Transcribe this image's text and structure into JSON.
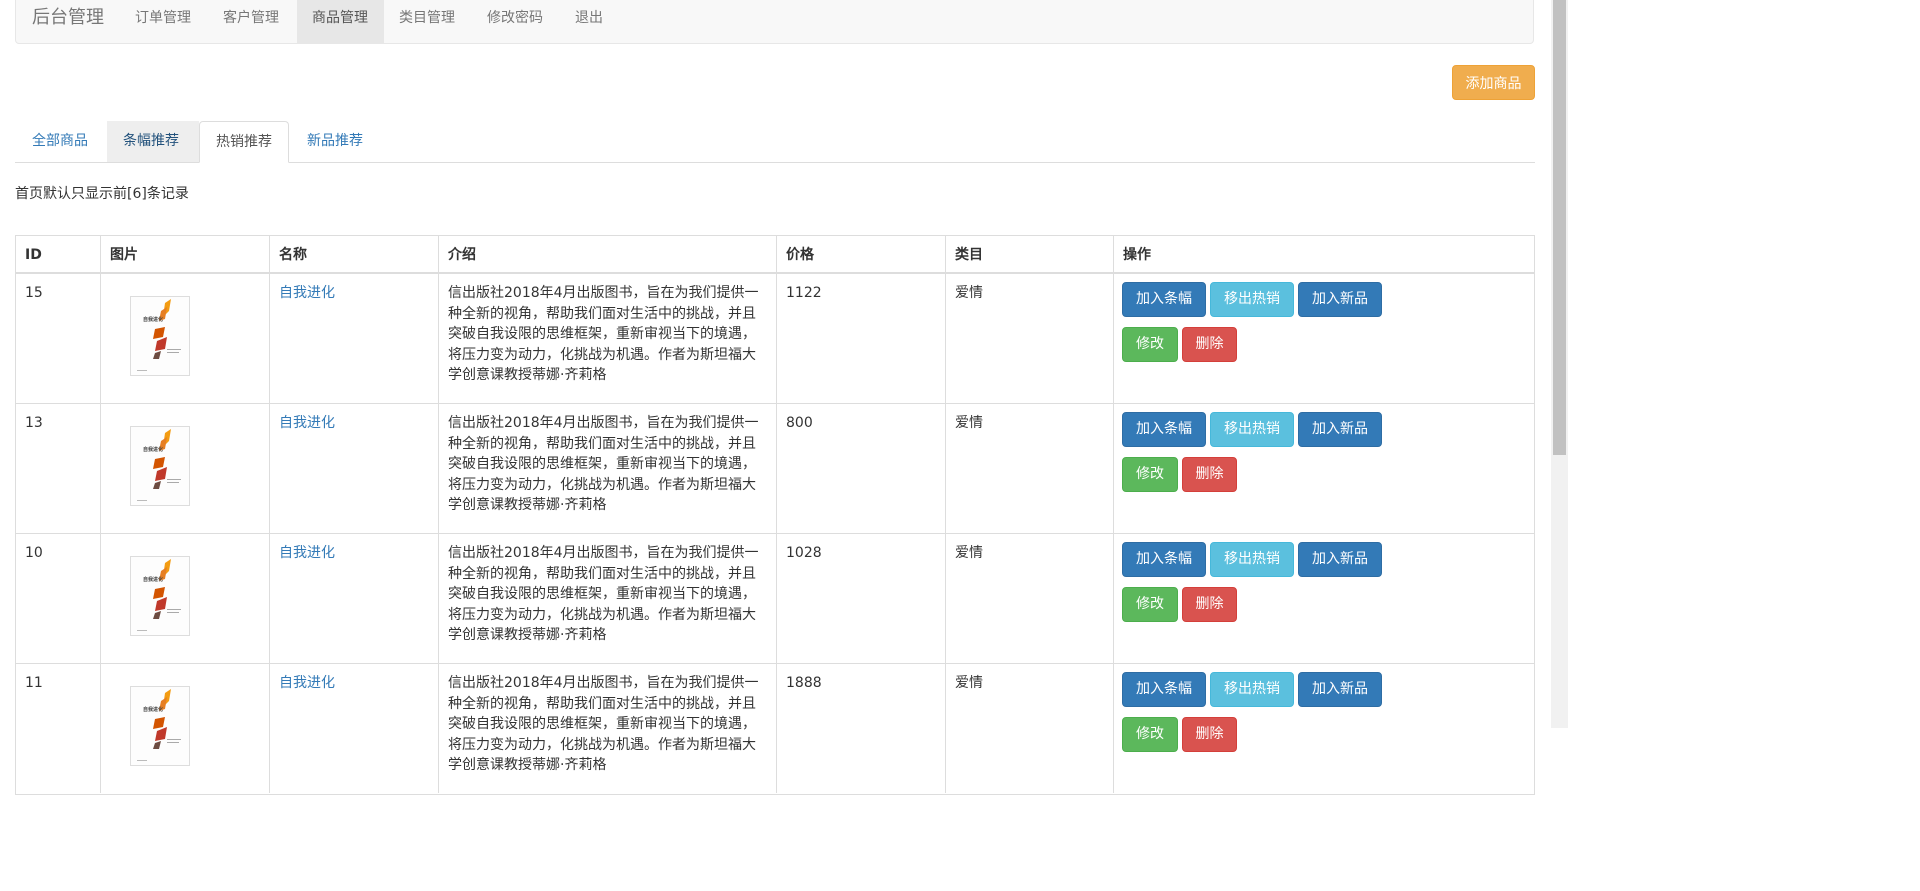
{
  "navbar": {
    "brand": "后台管理",
    "items": [
      {
        "label": "订单管理",
        "active": false
      },
      {
        "label": "客户管理",
        "active": false
      },
      {
        "label": "商品管理",
        "active": true
      },
      {
        "label": "类目管理",
        "active": false
      },
      {
        "label": "修改密码",
        "active": false
      },
      {
        "label": "退出",
        "active": false
      }
    ]
  },
  "add_button": "添加商品",
  "tabs": [
    {
      "label": "全部商品",
      "state": "normal"
    },
    {
      "label": "条幅推荐",
      "state": "hover"
    },
    {
      "label": "热销推荐",
      "state": "active"
    },
    {
      "label": "新品推荐",
      "state": "normal"
    }
  ],
  "notice": "首页默认只显示前[6]条记录",
  "table": {
    "headers": [
      "ID",
      "图片",
      "名称",
      "介绍",
      "价格",
      "类目",
      "操作"
    ],
    "cover_text": "自我进化",
    "actions": {
      "banner": "加入条幅",
      "hot": "移出热销",
      "new": "加入新品",
      "edit": "修改",
      "delete": "删除"
    },
    "rows": [
      {
        "id": "15",
        "name": "自我进化",
        "intro": "信出版社2018年4月出版图书，旨在为我们提供一种全新的视角，帮助我们面对生活中的挑战，并且突破自我设限的思维框架，重新审视当下的境遇，将压力变为动力，化挑战为机遇。作者为斯坦福大学创意课教授蒂娜·齐莉格",
        "price": "1122",
        "category": "爱情"
      },
      {
        "id": "13",
        "name": "自我进化",
        "intro": "信出版社2018年4月出版图书，旨在为我们提供一种全新的视角，帮助我们面对生活中的挑战，并且突破自我设限的思维框架，重新审视当下的境遇，将压力变为动力，化挑战为机遇。作者为斯坦福大学创意课教授蒂娜·齐莉格",
        "price": "800",
        "category": "爱情"
      },
      {
        "id": "10",
        "name": "自我进化",
        "intro": "信出版社2018年4月出版图书，旨在为我们提供一种全新的视角，帮助我们面对生活中的挑战，并且突破自我设限的思维框架，重新审视当下的境遇，将压力变为动力，化挑战为机遇。作者为斯坦福大学创意课教授蒂娜·齐莉格",
        "price": "1028",
        "category": "爱情"
      },
      {
        "id": "11",
        "name": "自我进化",
        "intro": "信出版社2018年4月出版图书，旨在为我们提供一种全新的视角，帮助我们面对生活中的挑战，并且突破自我设限的思维框架，重新审视当下的境遇，将压力变为动力，化挑战为机遇。作者为斯坦福大学创意课教授蒂娜·齐莉格",
        "price": "1888",
        "category": "爱情"
      }
    ]
  }
}
